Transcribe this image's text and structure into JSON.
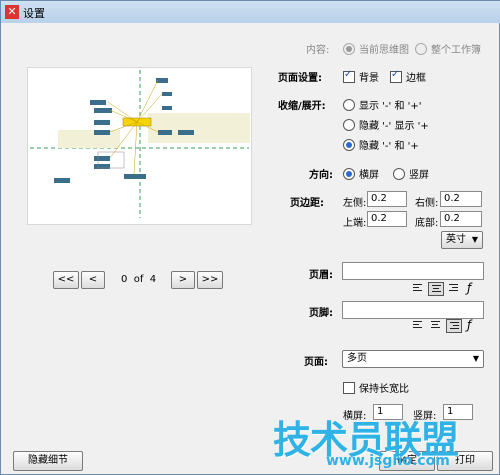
{
  "window": {
    "title": "设置"
  },
  "content": {
    "label": "内容:",
    "option_current": "当前思维图",
    "option_all": "整个工作簿"
  },
  "page_settings": {
    "label": "页面设置:",
    "background": "背景",
    "border": "边框"
  },
  "collapse": {
    "label": "收缩/展开:",
    "opt1": "显示 '-' 和 '+'",
    "opt2": "隐藏 '-' 显示 '+",
    "opt3": "隐藏 '-' 和 '+"
  },
  "orientation": {
    "label": "方向:",
    "landscape": "横屏",
    "portrait": "竖屏"
  },
  "margins": {
    "label": "页边距:",
    "left_label": "左侧:",
    "left": "0.2",
    "right_label": "右侧:",
    "right": "0.2",
    "top_label": "上端:",
    "top": "0.2",
    "bottom_label": "底部:",
    "bottom": "0.2",
    "unit": "英寸"
  },
  "header": {
    "label": "页眉:",
    "value": ""
  },
  "footer": {
    "label": "页脚:",
    "value": ""
  },
  "font_icon": "ƒ",
  "page": {
    "label": "页面:",
    "value": "多页",
    "keep_ratio": "保持长宽比",
    "h_label": "横屏:",
    "h_value": "1",
    "v_label": "竖屏:",
    "v_value": "1"
  },
  "pager": {
    "current": "0",
    "of": "of",
    "total": "4",
    "first": "<<",
    "prev": "<",
    "next": ">",
    "last": ">>"
  },
  "buttons": {
    "hide_details": "隐藏细节",
    "ok": "确定",
    "print": "打印"
  },
  "watermark": {
    "main": "技术员联盟",
    "url": "www.jsgho.com"
  }
}
